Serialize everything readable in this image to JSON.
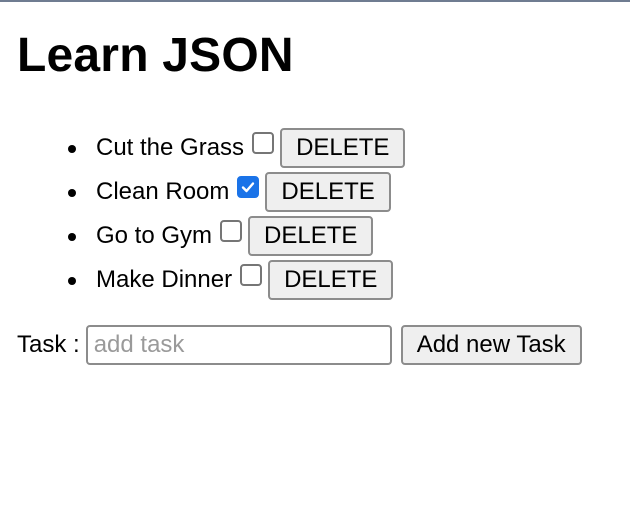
{
  "page": {
    "title": "Learn JSON"
  },
  "tasks": [
    {
      "label": "Cut the Grass",
      "checked": false,
      "delete_label": "DELETE"
    },
    {
      "label": "Clean Room",
      "checked": true,
      "delete_label": "DELETE"
    },
    {
      "label": "Go to Gym",
      "checked": false,
      "delete_label": "DELETE"
    },
    {
      "label": "Make Dinner",
      "checked": false,
      "delete_label": "DELETE"
    }
  ],
  "form": {
    "label": "Task :",
    "input_value": "",
    "input_placeholder": "add task",
    "submit_label": "Add new Task"
  },
  "colors": {
    "checkbox_checked": "#1a73e8",
    "button_bg": "#efefef",
    "top_border": "#6f7c91"
  },
  "icons": {
    "checkmark": "checkmark-icon"
  }
}
